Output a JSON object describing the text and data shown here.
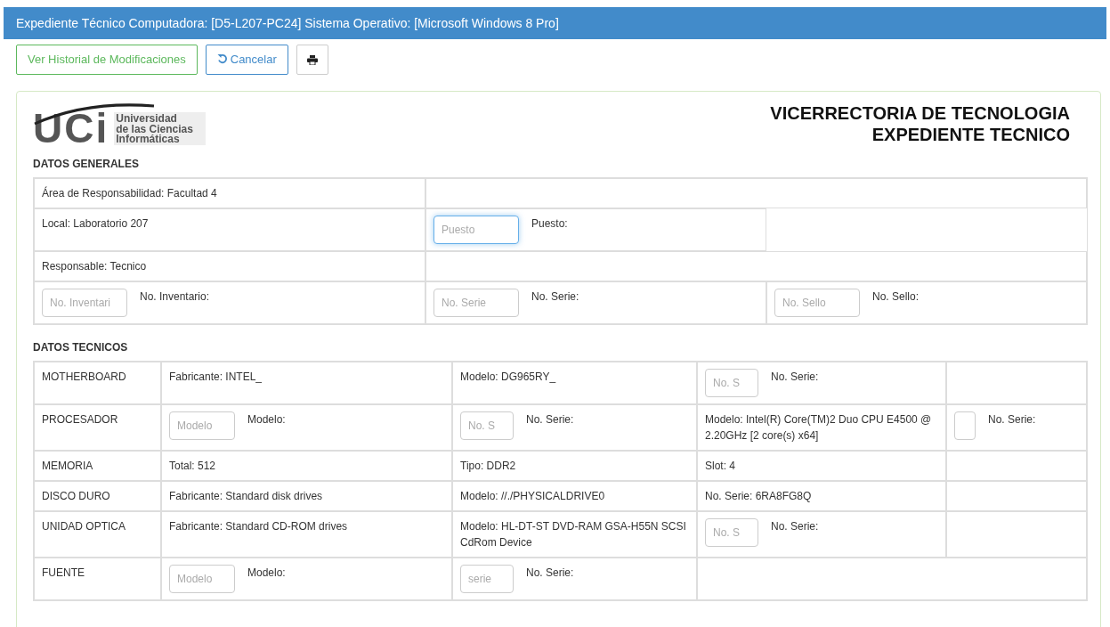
{
  "header": {
    "title": "Expediente Técnico Computadora: [D5-L207-PC24] Sistema Operativo: [Microsoft Windows 8 Pro]"
  },
  "toolbar": [
    {
      "kind": "history",
      "label": "Ver Historial de Modificaciones"
    },
    {
      "kind": "cancel",
      "label": "Cancelar"
    },
    {
      "kind": "print"
    }
  ],
  "logo": {
    "mark": "UCi",
    "lines": [
      "Universidad",
      "de las Ciencias",
      "Informáticas"
    ]
  },
  "heading": [
    "VICERRECTORIA DE TECNOLOGIA",
    "EXPEDIENTE TECNICO"
  ],
  "general": {
    "title": "DATOS GENERALES",
    "rows": [
      [
        {
          "kind": "text",
          "text": "Área de Responsabilidad: Facultad 4"
        }
      ],
      [
        {
          "kind": "text",
          "text": "Local: Laboratorio 207"
        },
        {
          "kind": "field",
          "placeholder": "Puesto",
          "label": "Puesto:",
          "focused": true
        }
      ],
      [
        {
          "kind": "text",
          "text": "Responsable: Tecnico"
        }
      ],
      [
        {
          "kind": "field",
          "placeholder": "No. Inventari",
          "label": "No. Inventario:",
          "focused": false
        },
        {
          "kind": "field",
          "placeholder": "No. Serie",
          "label": "No. Serie:",
          "focused": false
        },
        {
          "kind": "field",
          "placeholder": "No. Sello",
          "label": "No. Sello:",
          "focused": false
        }
      ]
    ]
  },
  "technical": {
    "title": "DATOS TECNICOS",
    "rows": [
      [
        {
          "kind": "text",
          "text": "MOTHERBOARD"
        },
        {
          "kind": "text",
          "text": "Fabricante: INTEL_"
        },
        {
          "kind": "text",
          "text": "Modelo: DG965RY_"
        },
        {
          "kind": "field",
          "placeholder": "No. S",
          "label": "No. Serie:",
          "focused": false
        }
      ],
      [
        {
          "kind": "text",
          "text": "PROCESADOR"
        },
        {
          "kind": "field",
          "placeholder": "Modelo",
          "label": "Modelo:",
          "focused": false
        },
        {
          "kind": "field",
          "placeholder": "No. S",
          "label": "No. Serie:",
          "focused": false
        },
        {
          "kind": "text",
          "text": "Modelo: Intel(R) Core(TM)2 Duo CPU E4500 @ 2.20GHz [2 core(s) x64]"
        },
        {
          "kind": "field",
          "label": "No. Serie:",
          "focused": false
        }
      ],
      [
        {
          "kind": "text",
          "text": "MEMORIA"
        },
        {
          "kind": "text",
          "text": "Total: 512"
        },
        {
          "kind": "text",
          "text": "Tipo: DDR2"
        },
        {
          "kind": "text",
          "text": "Slot: 4"
        }
      ],
      [
        {
          "kind": "text",
          "text": "DISCO DURO"
        },
        {
          "kind": "text",
          "text": "Fabricante: Standard disk drives"
        },
        {
          "kind": "text",
          "text": "Modelo: //./PHYSICALDRIVE0"
        },
        {
          "kind": "text",
          "text": "No. Serie: 6RA8FG8Q"
        }
      ],
      [
        {
          "kind": "text",
          "text": "UNIDAD OPTICA"
        },
        {
          "kind": "text",
          "text": "Fabricante: Standard CD-ROM drives"
        },
        {
          "kind": "text",
          "text": "Modelo: HL-DT-ST DVD-RAM GSA-H55N SCSI CdRom Device"
        },
        {
          "kind": "field",
          "placeholder": "No. S",
          "label": "No. Serie:",
          "focused": false
        }
      ],
      [
        {
          "kind": "text",
          "text": "FUENTE"
        },
        {
          "kind": "field",
          "placeholder": "Modelo",
          "label": "Modelo:",
          "focused": false
        },
        {
          "kind": "field",
          "placeholder": "serie",
          "label": "No. Serie:",
          "focused": false
        }
      ]
    ]
  }
}
